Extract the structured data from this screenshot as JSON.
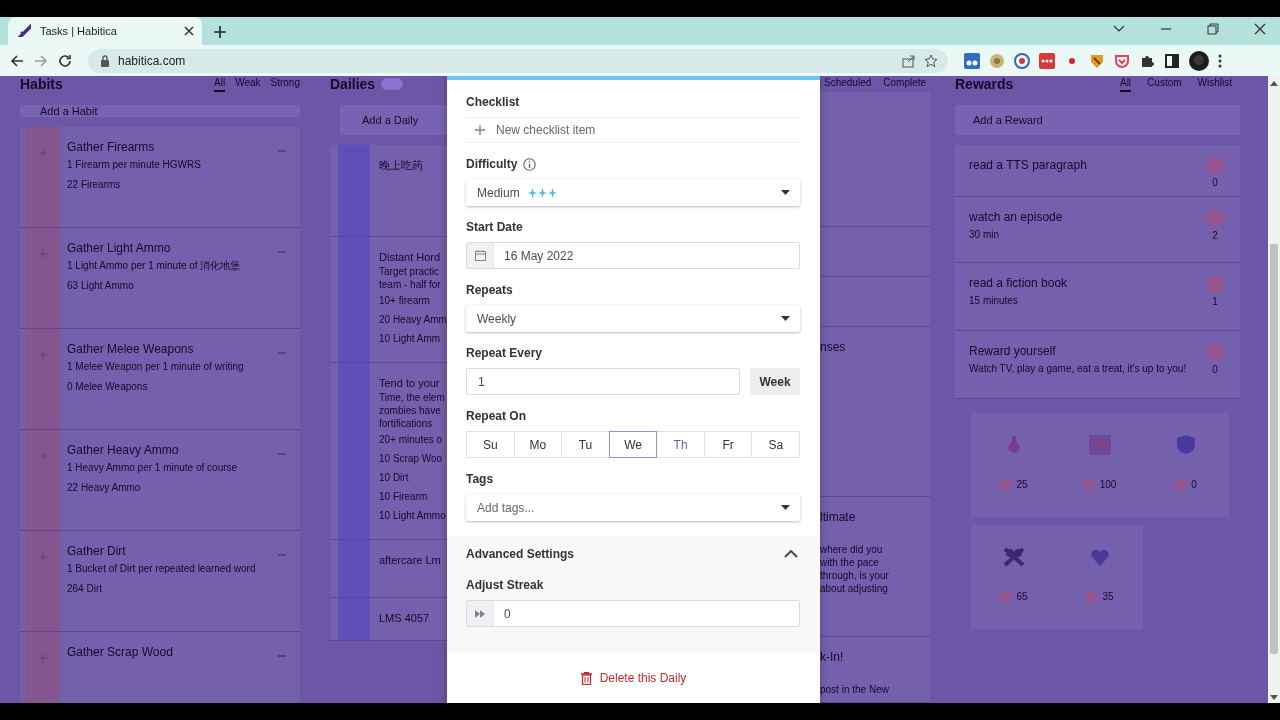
{
  "browser": {
    "tab": {
      "title": "Tasks | Habitica"
    },
    "url": "habitica.com"
  },
  "habits": {
    "title": "Habits",
    "filters": [
      {
        "label": "All",
        "selected": true
      },
      {
        "label": "Weak",
        "selected": false
      },
      {
        "label": "Strong",
        "selected": false
      }
    ],
    "add_placeholder": "Add a Habit",
    "items": [
      {
        "title": "Gather Firearms",
        "notes": "1 Firearm per minute HGWRS",
        "count": "22 Firearms"
      },
      {
        "title": "Gather Light Ammo",
        "notes": "1 Light Ammo per 1 minute of 消化地堡",
        "count": "63 Light Ammo"
      },
      {
        "title": "Gather Melee Weapons",
        "notes": "1 Melee Weapon per 1 minute of writing",
        "count": "0 Melee Weapons"
      },
      {
        "title": "Gather Heavy Ammo",
        "notes": "1 Heavy Ammo per 1 minute of course",
        "count": "22 Heavy Ammo"
      },
      {
        "title": "Gather Dirt",
        "notes": "1 Bucket of Dirt per repeated learned word",
        "count": "264 Dirt"
      },
      {
        "title": "Gather Scrap Wood"
      }
    ]
  },
  "dailies": {
    "title": "Dailies",
    "add_placeholder": "Add a Daily",
    "items": [
      {
        "title": "晚上吃药"
      },
      {
        "title": "Distant Hord",
        "notes": [
          "Target practic",
          "team - half for"
        ],
        "checklist": [
          "10+ firearm",
          "20 Heavy Amm",
          "10 Light Amm"
        ]
      },
      {
        "title": "Tend to your",
        "notes": [
          "Time, the elem",
          "zombies have",
          "fortifications"
        ],
        "checklist": [
          "20+ minutes o",
          "10 Scrap Woo",
          "10 Dirt",
          "10 Firearm",
          "10 Light Ammo"
        ]
      },
      {
        "title": "aftercare Lm"
      },
      {
        "title": "LMS 4057"
      }
    ]
  },
  "todos": {
    "filters": [
      {
        "label": "Scheduled",
        "selected": false
      },
      {
        "label": "Complete",
        "selected": false
      }
    ],
    "items": [
      {
        "title": "nses"
      },
      {
        "title": "ltimate",
        "notes": [
          "where did you",
          "with the pace",
          "through, is your",
          "about adjusting"
        ]
      },
      {
        "title": "k-In!",
        "notes": [
          "post in the New"
        ]
      }
    ]
  },
  "rewards": {
    "title": "Rewards",
    "filters": [
      {
        "label": "All",
        "selected": true
      },
      {
        "label": "Custom",
        "selected": false
      },
      {
        "label": "Wishlist",
        "selected": false
      }
    ],
    "add_placeholder": "Add a Reward",
    "items": [
      {
        "title": "read a TTS paragraph",
        "price": "0"
      },
      {
        "title": "watch an episode",
        "notes": "30 min",
        "price": "2"
      },
      {
        "title": "read a fiction book",
        "notes": "15 minutes",
        "price": "1"
      },
      {
        "title": "Reward yourself",
        "notes": "Watch TV, play a game, eat a treat, it's up to you!",
        "price": "0"
      }
    ],
    "shop": [
      {
        "kind": "potion",
        "price": "25"
      },
      {
        "kind": "armoire",
        "price": "100"
      },
      {
        "kind": "shield",
        "price": "0"
      },
      {
        "kind": "bones",
        "price": "65"
      },
      {
        "kind": "heart",
        "price": "35"
      }
    ]
  },
  "task_editor": {
    "checklist": {
      "label": "Checklist",
      "placeholder": "New checklist item"
    },
    "difficulty": {
      "label": "Difficulty",
      "value": "Medium",
      "stars": 3
    },
    "start_date": {
      "label": "Start Date",
      "value": "16 May 2022"
    },
    "repeats": {
      "label": "Repeats",
      "value": "Weekly"
    },
    "repeat_every": {
      "label": "Repeat Every",
      "value": "1",
      "unit": "Week"
    },
    "repeat_on": {
      "label": "Repeat On",
      "days": [
        {
          "label": "Su",
          "selected": false,
          "hovered": false
        },
        {
          "label": "Mo",
          "selected": false,
          "hovered": false
        },
        {
          "label": "Tu",
          "selected": false,
          "hovered": false
        },
        {
          "label": "We",
          "selected": true,
          "hovered": false
        },
        {
          "label": "Th",
          "selected": false,
          "hovered": true
        },
        {
          "label": "Fr",
          "selected": false,
          "hovered": false
        },
        {
          "label": "Sa",
          "selected": false,
          "hovered": false
        }
      ]
    },
    "tags": {
      "label": "Tags",
      "placeholder": "Add tags..."
    },
    "advanced": {
      "title": "Advanced Settings",
      "expanded": true,
      "adjust_streak": {
        "label": "Adjust Streak",
        "value": "0"
      }
    },
    "delete_label": "Delete this Daily"
  }
}
